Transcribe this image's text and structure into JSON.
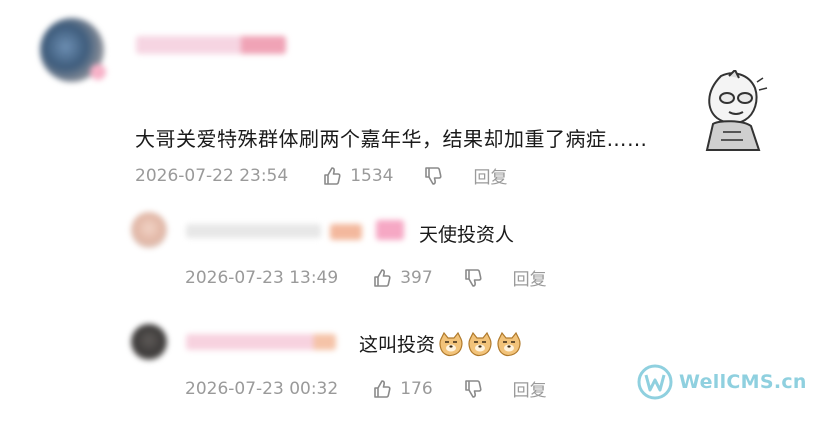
{
  "main_comment": {
    "text": "大哥关爱特殊群体刷两个嘉年华，结果却加重了病症……",
    "time": "2026-07-22 23:54",
    "likes": "1534",
    "reply_label": "回复"
  },
  "replies": [
    {
      "text": "天使投资人",
      "time": "2026-07-23 13:49",
      "likes": "397",
      "reply_label": "回复"
    },
    {
      "text": "这叫投资",
      "time": "2026-07-23 00:32",
      "likes": "176",
      "reply_label": "回复"
    }
  ],
  "icons": {
    "like": "thumbs-up-icon",
    "dislike": "thumbs-down-icon",
    "emoji": "doge-emoji-icon",
    "sticker": "ultraman-sticker-icon"
  },
  "watermark": {
    "text": "WellCMS.cn"
  }
}
